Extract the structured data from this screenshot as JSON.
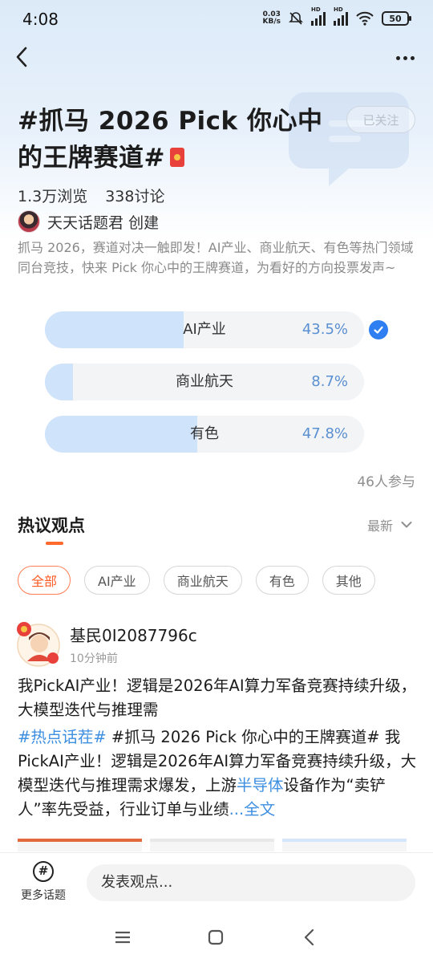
{
  "status_bar": {
    "time": "4:08",
    "net_speed_value": "0.03",
    "net_speed_unit": "KB/s",
    "signal_label": "HD",
    "battery": "50"
  },
  "topic": {
    "title": "#抓马 2026  Pick 你心中的王牌赛道#",
    "follow_label": "已关注",
    "views": "1.3万浏览",
    "discussions": "338讨论",
    "creator_name": "天天话题君",
    "creator_suffix": "创建",
    "description": "抓马 2026，赛道对决一触即发！AI产业、商业航天、有色等热门领域同台竞技，快来 Pick 你心中的王牌赛道，为看好的方向投票发声~"
  },
  "poll": {
    "options": [
      {
        "label": "AI产业",
        "percent_text": "43.5%",
        "fraction": 0.435,
        "selected": true
      },
      {
        "label": "商业航天",
        "percent_text": "8.7%",
        "fraction": 0.087,
        "selected": false
      },
      {
        "label": "有色",
        "percent_text": "47.8%",
        "fraction": 0.478,
        "selected": false
      }
    ],
    "participants": "46人参与"
  },
  "discussion": {
    "title": "热议观点",
    "sort_label": "最新",
    "filters": [
      {
        "label": "全部",
        "active": true
      },
      {
        "label": "AI产业",
        "active": false
      },
      {
        "label": "商业航天",
        "active": false
      },
      {
        "label": "有色",
        "active": false
      },
      {
        "label": "其他",
        "active": false
      }
    ]
  },
  "post": {
    "username": "基民0I2087796c",
    "time": "10分钟前",
    "headline": "我PickAI产业！逻辑是2026年AI算力军备竞赛持续升级，大模型迭代与推理需",
    "hashtag_hot": "#热点话茬#",
    "hashtag_topic": " #抓马 2026 Pick 你心中的王牌赛道# 我PickAI产业！逻辑是2026年AI算力军备竞赛持续升级，大模型迭代与推理需求爆发，上游",
    "link_semiconductor": "半导体",
    "body_tail": "设备作为“卖铲人”率先受益，行业订单与业绩",
    "read_more": "...全文"
  },
  "bottom_bar": {
    "more_topics": "更多话题",
    "comment_placeholder": "发表观点..."
  },
  "colors": {
    "accent_orange": "#ff5b25",
    "link_blue": "#3e8fe0",
    "poll_fill": "#cfe3fb",
    "check_blue": "#2f7ef2"
  }
}
